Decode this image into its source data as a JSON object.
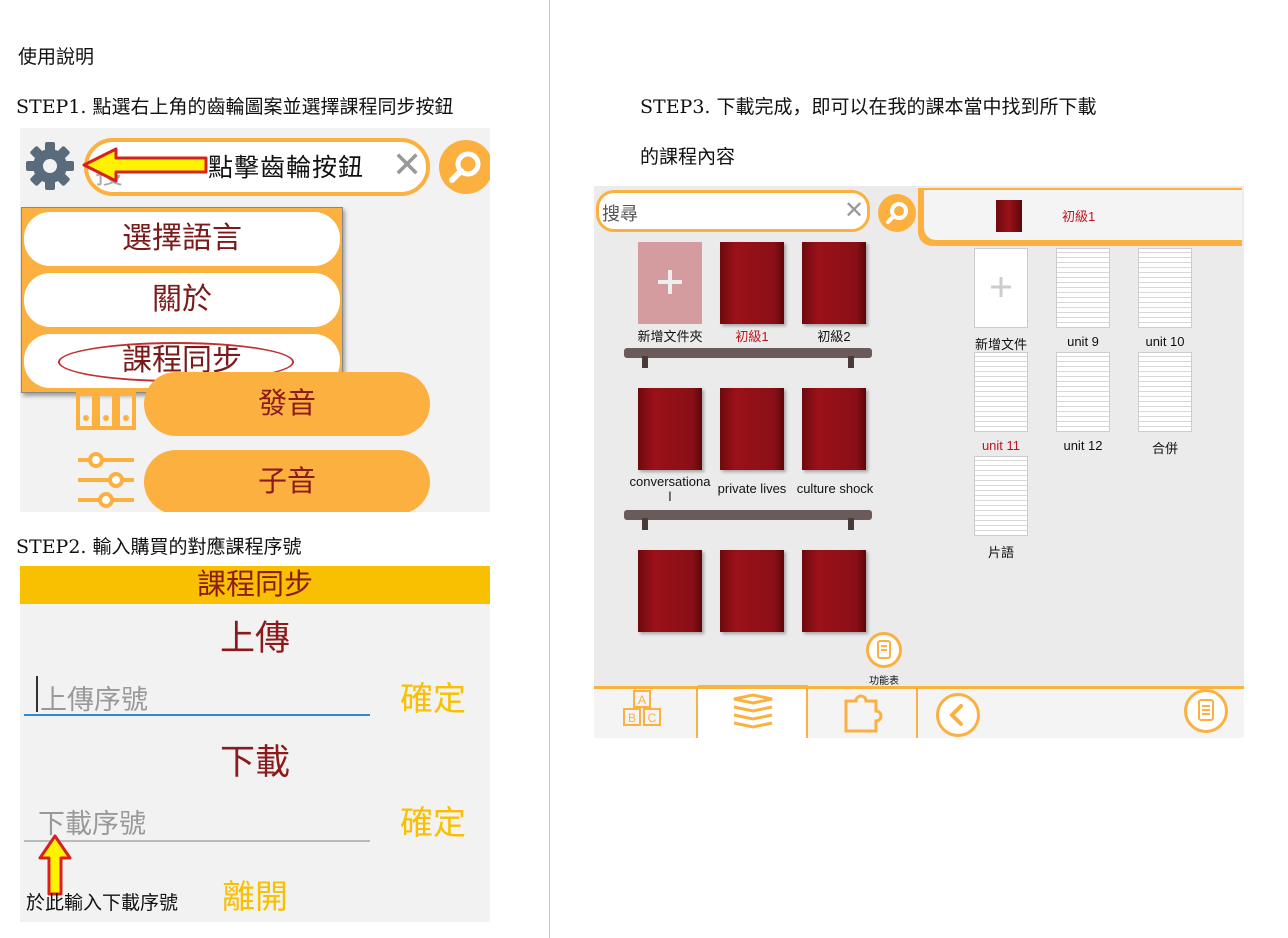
{
  "page": {
    "heading": "使用說明",
    "step1": "STEP1. 點選右上角的齒輪圖案並選擇課程同步按鈕",
    "step2": "STEP2. 輸入購買的對應課程序號",
    "step3_line1": "STEP3. 下載完成，即可以在我的課本當中找到所下載",
    "step3_line2": "的課程內容"
  },
  "shot1": {
    "search_placeholder": "搜",
    "clear_icon": "close-icon",
    "arrow_annotation": "點擊齒輪按鈕",
    "menu_items": [
      "選擇語言",
      "關於",
      "課程同步"
    ],
    "buttons": [
      "發音",
      "子音"
    ],
    "accent_color": "#fbb040"
  },
  "shot2": {
    "header": "課程同步",
    "upload_title": "上傳",
    "upload_placeholder": "上傳序號",
    "upload_confirm": "確定",
    "download_title": "下載",
    "download_placeholder": "下載序號",
    "download_confirm": "確定",
    "annotation": "於此輸入下載序號",
    "exit_label": "離開"
  },
  "shot3": {
    "search_placeholder": "搜尋",
    "active_tab": "初級1",
    "shelf1": [
      "新增文件夾",
      "初級1",
      "初級2"
    ],
    "shelf2": [
      "conversationa l",
      "private lives",
      "culture shock"
    ],
    "docs": [
      "新增文件",
      "unit 9",
      "unit 10",
      "unit 11",
      "unit 12",
      "合併",
      "片語"
    ],
    "menu_label": "功能表",
    "bottom_tabs": [
      "",
      "",
      ""
    ],
    "back_label": "前一頁",
    "right_menu_label": "功能表",
    "highlight_color": "#c1121f"
  }
}
